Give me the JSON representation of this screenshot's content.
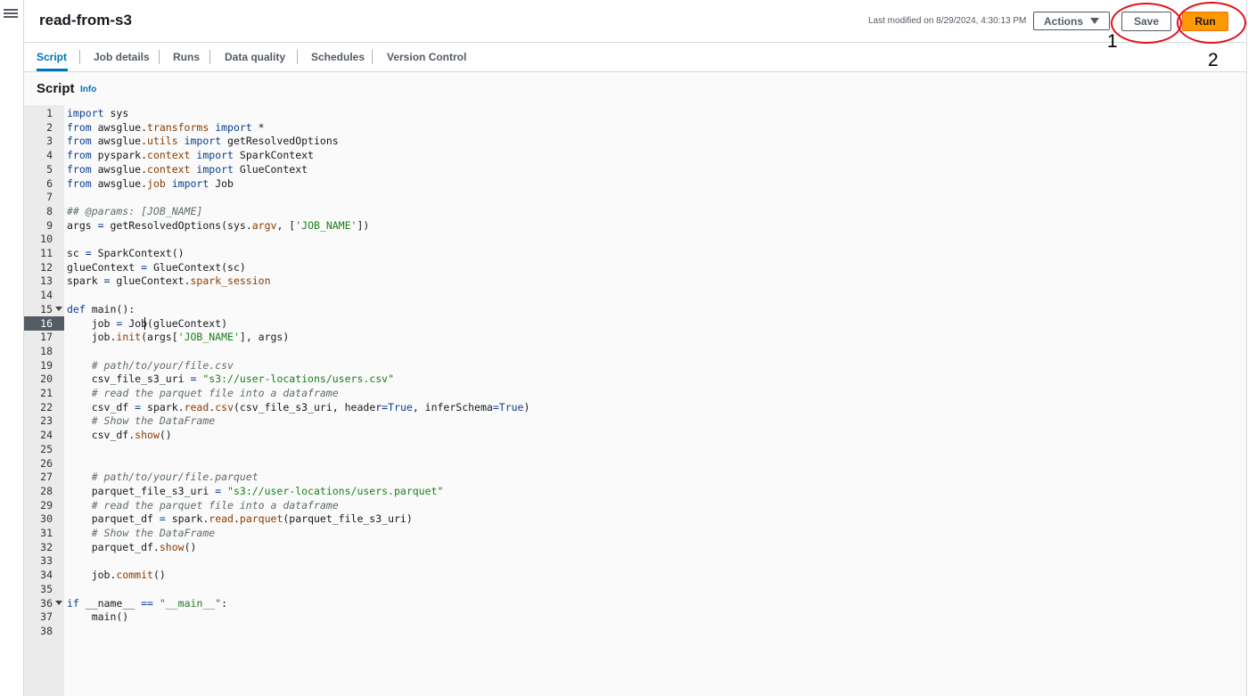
{
  "nav": {
    "menu_icon": "hamburger-menu-icon"
  },
  "header": {
    "title": "read-from-s3",
    "last_modified": "Last modified on 8/29/2024, 4:30:13 PM",
    "actions_label": "Actions",
    "save_label": "Save",
    "run_label": "Run"
  },
  "annotations": {
    "save_number": "1",
    "run_number": "2",
    "color": "#e0101a"
  },
  "tabs": [
    {
      "label": "Script",
      "active": true
    },
    {
      "label": "Job details",
      "active": false
    },
    {
      "label": "Runs",
      "active": false
    },
    {
      "label": "Data quality",
      "active": false
    },
    {
      "label": "Schedules",
      "active": false
    },
    {
      "label": "Version Control",
      "active": false
    }
  ],
  "script_section": {
    "title": "Script",
    "info_label": "Info"
  },
  "editor": {
    "active_line": 16,
    "lines": [
      "import sys",
      "from awsglue.transforms import *",
      "from awsglue.utils import getResolvedOptions",
      "from pyspark.context import SparkContext",
      "from awsglue.context import GlueContext",
      "from awsglue.job import Job",
      "",
      "## @params: [JOB_NAME]",
      "args = getResolvedOptions(sys.argv, ['JOB_NAME'])",
      "",
      "sc = SparkContext()",
      "glueContext = GlueContext(sc)",
      "spark = glueContext.spark_session",
      "",
      "def main():",
      "    job = Job(glueContext)",
      "    job.init(args['JOB_NAME'], args)",
      "",
      "    # path/to/your/file.csv",
      "    csv_file_s3_uri = \"s3://user-locations/users.csv\"",
      "    # read the parquet file into a dataframe",
      "    csv_df = spark.read.csv(csv_file_s3_uri, header=True, inferSchema=True)",
      "    # Show the DataFrame",
      "    csv_df.show()",
      "",
      "",
      "    # path/to/your/file.parquet",
      "    parquet_file_s3_uri = \"s3://user-locations/users.parquet\"",
      "    # read the parquet file into a dataframe",
      "    parquet_df = spark.read.parquet(parquet_file_s3_uri)",
      "    # Show the DataFrame",
      "    parquet_df.show()",
      "",
      "    job.commit()",
      "",
      "if __name__ == \"__main__\":",
      "    main()",
      ""
    ],
    "fold_lines": [
      15,
      36
    ]
  },
  "colors": {
    "accent": "#0073bb",
    "run_button": "#ff9900",
    "keyword": "#0b3d91",
    "string": "#1a7f1a",
    "comment": "#5f6b6d",
    "property": "#8a3b00"
  }
}
